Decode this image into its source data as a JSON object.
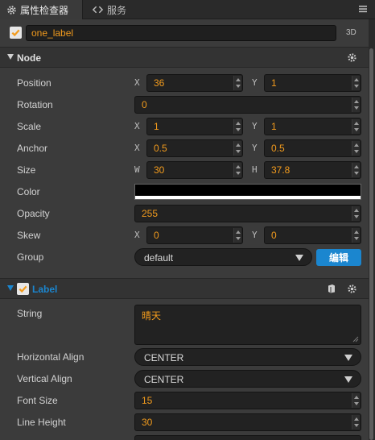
{
  "tabs": [
    {
      "label": "属性检查器",
      "icon": "gear-icon",
      "active": true
    },
    {
      "label": "服务",
      "icon": "link-icon",
      "active": false
    }
  ],
  "node": {
    "enabled": true,
    "name": "one_label",
    "mode_tag": "3D"
  },
  "node_section": {
    "title": "Node",
    "position": {
      "label": "Position",
      "x_axis": "X",
      "x": "36",
      "y_axis": "Y",
      "y": "1"
    },
    "rotation": {
      "label": "Rotation",
      "value": "0"
    },
    "scale": {
      "label": "Scale",
      "x_axis": "X",
      "x": "1",
      "y_axis": "Y",
      "y": "1"
    },
    "anchor": {
      "label": "Anchor",
      "x_axis": "X",
      "x": "0.5",
      "y_axis": "Y",
      "y": "0.5"
    },
    "size": {
      "label": "Size",
      "w_axis": "W",
      "w": "30",
      "h_axis": "H",
      "h": "37.8"
    },
    "color": {
      "label": "Color",
      "value": "#000000"
    },
    "opacity": {
      "label": "Opacity",
      "value": "255"
    },
    "skew": {
      "label": "Skew",
      "x_axis": "X",
      "x": "0",
      "y_axis": "Y",
      "y": "0"
    },
    "group": {
      "label": "Group",
      "value": "default",
      "edit_button": "编辑"
    }
  },
  "label_section": {
    "title": "Label",
    "enabled": true,
    "accent": "#1b86cf",
    "string": {
      "label": "String",
      "value": "晴天"
    },
    "horizontal_align": {
      "label": "Horizontal Align",
      "value": "CENTER"
    },
    "vertical_align": {
      "label": "Vertical Align",
      "value": "CENTER"
    },
    "font_size": {
      "label": "Font Size",
      "value": "15"
    },
    "line_height": {
      "label": "Line Height",
      "value": "30"
    }
  },
  "colors": {
    "value_text": "#f29b1d",
    "panel_bg": "#3b3b3b"
  }
}
